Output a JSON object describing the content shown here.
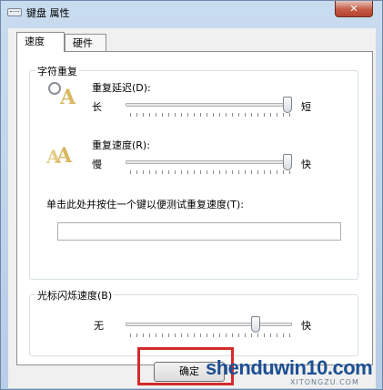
{
  "window": {
    "title": "键盘 属性",
    "close_label": "✕"
  },
  "tabs": [
    {
      "label": "速度"
    },
    {
      "label": "硬件"
    }
  ],
  "repeat_group": {
    "legend": "字符重复",
    "delay": {
      "label": "重复延迟(D):",
      "min_label": "长",
      "max_label": "短",
      "value_fraction": 1.0
    },
    "rate": {
      "label": "重复速度(R):",
      "min_label": "慢",
      "max_label": "快",
      "value_fraction": 1.0
    },
    "test_label": "单击此处并按住一个键以便测试重复速度(T):",
    "test_value": ""
  },
  "blink_group": {
    "legend": "光标闪烁速度(B)",
    "min_label": "无",
    "max_label": "快",
    "value_fraction": 0.8
  },
  "buttons": {
    "ok_label": "确定"
  },
  "watermark": {
    "text": "shenduwin10.com",
    "sub": "XITONGZU.COM"
  },
  "colors": {
    "highlight": "#d42a2a",
    "watermark": "#1d4f93"
  }
}
